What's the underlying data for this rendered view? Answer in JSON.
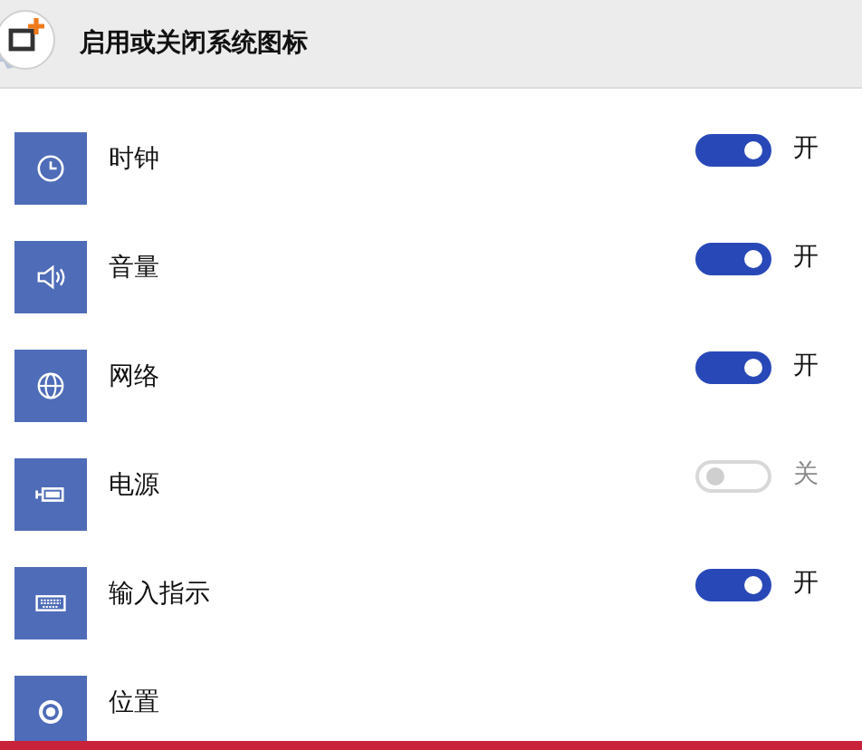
{
  "header": {
    "title": "启用或关闭系统图标"
  },
  "items": [
    {
      "label": "时钟",
      "on": true,
      "state_text": "开"
    },
    {
      "label": "音量",
      "on": true,
      "state_text": "开"
    },
    {
      "label": "网络",
      "on": true,
      "state_text": "开"
    },
    {
      "label": "电源",
      "on": false,
      "state_text": "关"
    },
    {
      "label": "输入指示",
      "on": true,
      "state_text": "开"
    },
    {
      "label": "位置"
    }
  ]
}
